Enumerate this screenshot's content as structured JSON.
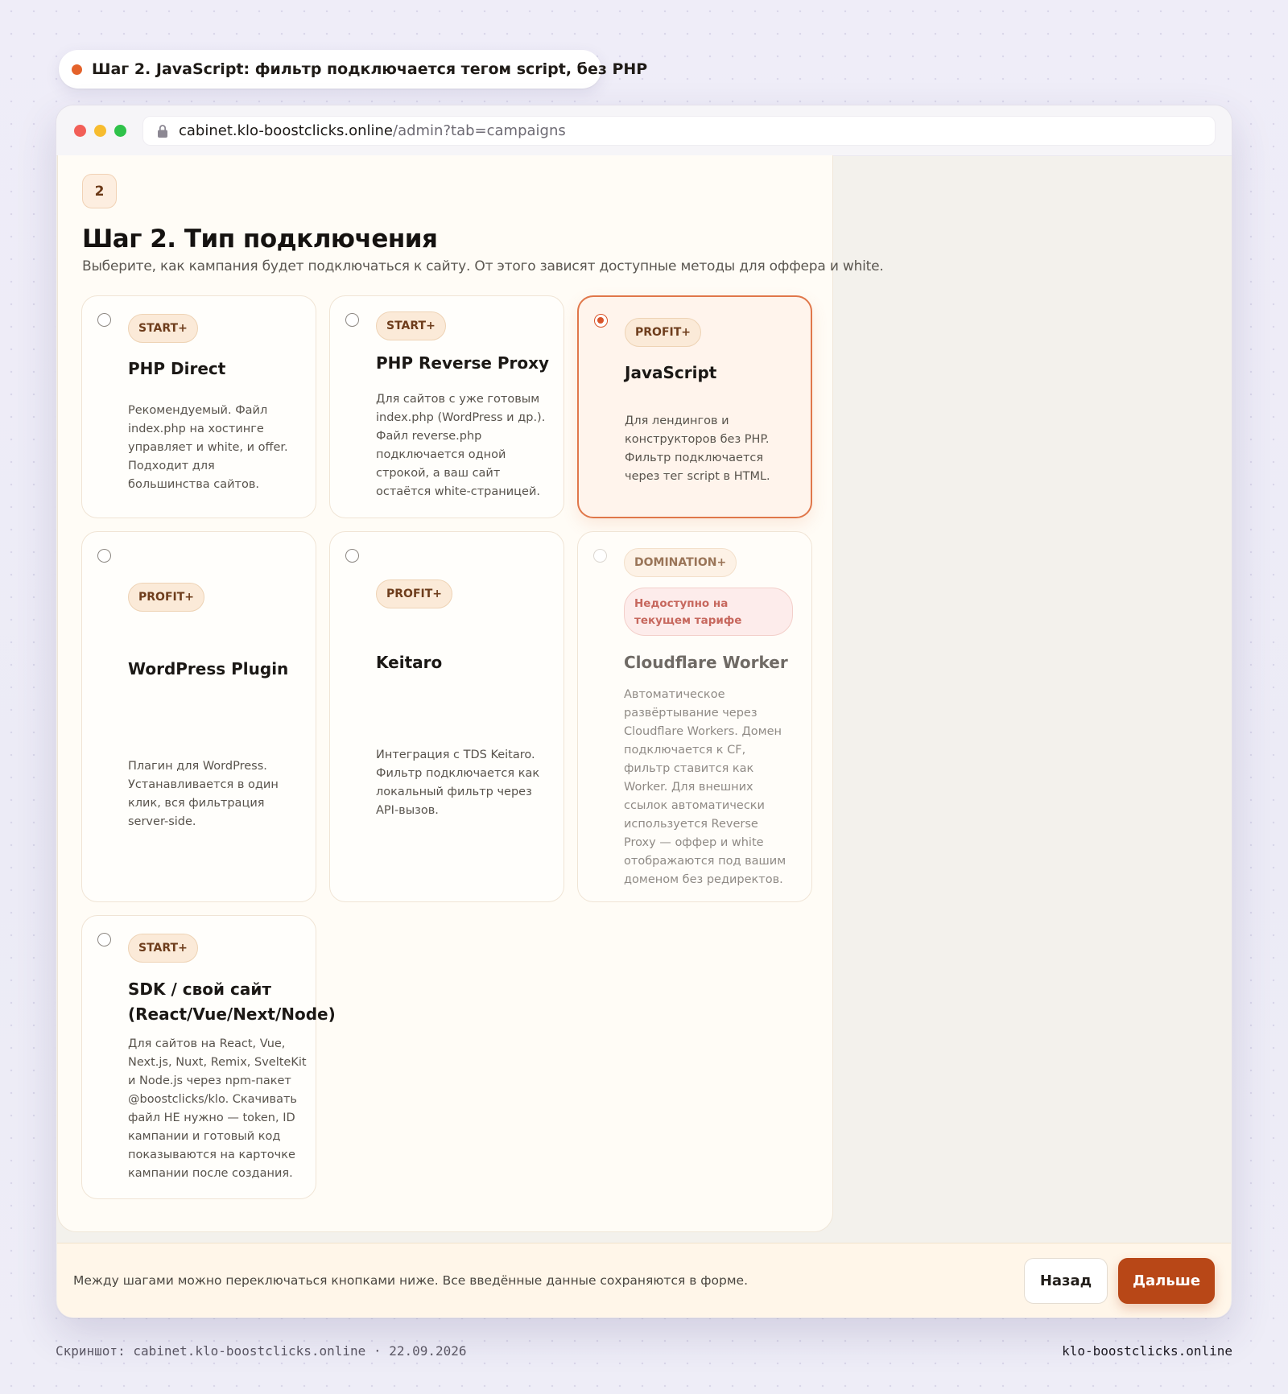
{
  "step_pill": {
    "text": "Шаг 2. JavaScript: фильтр подключается тегом script, без PHP"
  },
  "browser": {
    "url_host": "cabinet.klo-boostclicks.online",
    "url_path": "/admin?tab=campaigns"
  },
  "main": {
    "step_number": "2",
    "title": "Шаг 2. Тип подключения",
    "subtitle": "Выберите, как кампания будет подключаться к сайту. От этого зависят доступные методы для оффера и white."
  },
  "options": [
    {
      "tier": "START+",
      "title": "PHP Direct",
      "description": "Рекомендуемый. Файл index.php на хостинге управляет и white, и offer. Подходит для большинства сайтов.",
      "selected": false
    },
    {
      "tier": "START+",
      "title": "PHP Reverse Proxy",
      "description": "Для сайтов с уже готовым index.php (WordPress и др.). Файл reverse.php подключается одной строкой, а ваш сайт остаётся white-страницей.",
      "selected": false
    },
    {
      "tier": "PROFIT+",
      "title": "JavaScript",
      "description": "Для лендингов и конструкторов без PHP. Фильтр подключается через тег script в HTML.",
      "selected": true
    },
    {
      "tier": "PROFIT+",
      "title": "WordPress Plugin",
      "description": "Плагин для WordPress. Устанавливается в один клик, вся фильтрация server-side.",
      "selected": false
    },
    {
      "tier": "PROFIT+",
      "title": "Keitaro",
      "description": "Интеграция с TDS Keitaro. Фильтр подключается как локальный фильтр через API-вызов.",
      "selected": false
    },
    {
      "tier": "DOMINATION+",
      "unavailable_label": "Недоступно на текущем тарифе",
      "title": "Cloudflare Worker",
      "description": "Автоматическое развёртывание через Cloudflare Workers. Домен подключается к CF, фильтр ставится как Worker. Для внешних ссылок автоматически используется Reverse Proxy — оффер и white отображаются под вашим доменом без редиректов.",
      "selected": false,
      "disabled": true
    },
    {
      "tier": "START+",
      "title": "SDK / свой сайт (React/Vue/Next/Node)",
      "description": "Для сайтов на React, Vue, Next.js, Nuxt, Remix, SvelteKit и Node.js через npm-пакет @boostclicks/klo. Скачивать файл НЕ нужно — token, ID кампании и готовый код показываются на карточке кампании после создания.",
      "selected": false
    }
  ],
  "footer": {
    "hint": "Между шагами можно переключаться кнопками ниже. Все введённые данные сохраняются в форме.",
    "back_label": "Назад",
    "next_label": "Дальше"
  },
  "caption": {
    "left": "Скриншот: cabinet.klo-boostclicks.online · 22.09.2026",
    "right": "klo-boostclicks.online"
  },
  "colors": {
    "accent": "#d9542a",
    "primary_button": "#b84717",
    "tier_badge_bg": "#fbead8",
    "unavailable_text": "#c7685e"
  },
  "icons": [
    "lock-icon",
    "radio-icon"
  ]
}
